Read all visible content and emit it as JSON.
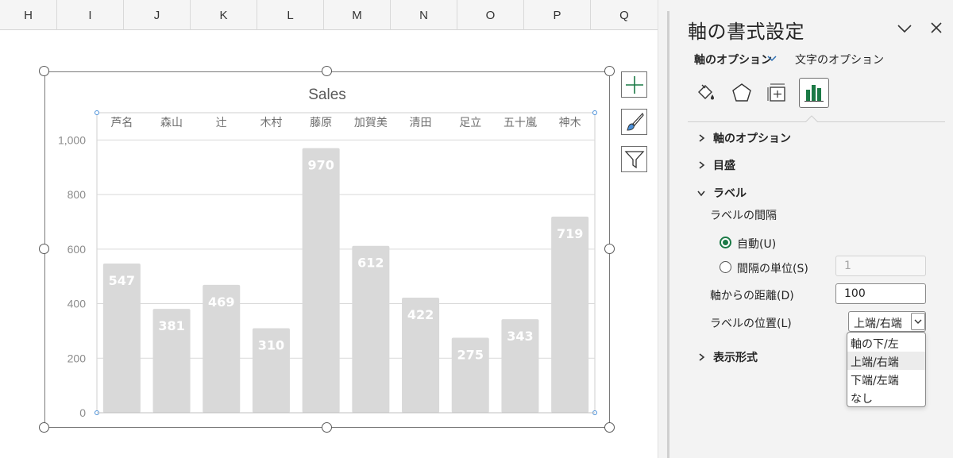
{
  "sheet": {
    "columns": [
      "H",
      "I",
      "J",
      "K",
      "L",
      "M",
      "N",
      "O",
      "P",
      "Q"
    ]
  },
  "chart_data": {
    "type": "bar",
    "title": "Sales",
    "categories": [
      "芦名",
      "森山",
      "辻",
      "木村",
      "藤原",
      "加賀美",
      "清田",
      "足立",
      "五十嵐",
      "神木"
    ],
    "values": [
      547,
      381,
      469,
      310,
      970,
      612,
      422,
      275,
      343,
      719
    ],
    "data_labels": [
      "547",
      "381",
      "469",
      "310",
      "970",
      "612",
      "422",
      "275",
      "343",
      "719"
    ],
    "y_ticks": [
      0,
      200,
      400,
      600,
      800,
      1000
    ],
    "y_tick_labels": [
      "0",
      "200",
      "400",
      "600",
      "800",
      "1,000"
    ],
    "ylim": [
      0,
      1100
    ],
    "category_axis_position": "top",
    "grid": true,
    "bar_color": "#d9d9d9",
    "label_color": "#ffffff"
  },
  "chart_tools": {
    "icons": [
      "chart-elements-icon",
      "chart-styles-icon",
      "chart-filters-icon"
    ]
  },
  "pane": {
    "title": "軸の書式設定",
    "tabs": [
      {
        "label": "軸のオプション",
        "active": true
      },
      {
        "label": "文字のオプション",
        "active": false
      }
    ],
    "icons": [
      "fill-line-icon",
      "effects-icon",
      "size-properties-icon",
      "axis-options-icon"
    ],
    "sections": {
      "axis_options": "軸のオプション",
      "tick_marks": "目盛",
      "labels": "ラベル",
      "number_format": "表示形式"
    },
    "labels": {
      "interval_heading": "ラベルの間隔",
      "auto": "自動(U)",
      "interval_unit": "間隔の単位(S)",
      "interval_unit_value": "1",
      "distance_label": "軸からの距離(D)",
      "distance_value": "100",
      "position_label": "ラベルの位置(L)",
      "position_value": "上端/右端",
      "position_options": [
        "軸の下/左",
        "上端/右端",
        "下端/左端",
        "なし"
      ]
    },
    "accent_color": "#1b7a46"
  }
}
